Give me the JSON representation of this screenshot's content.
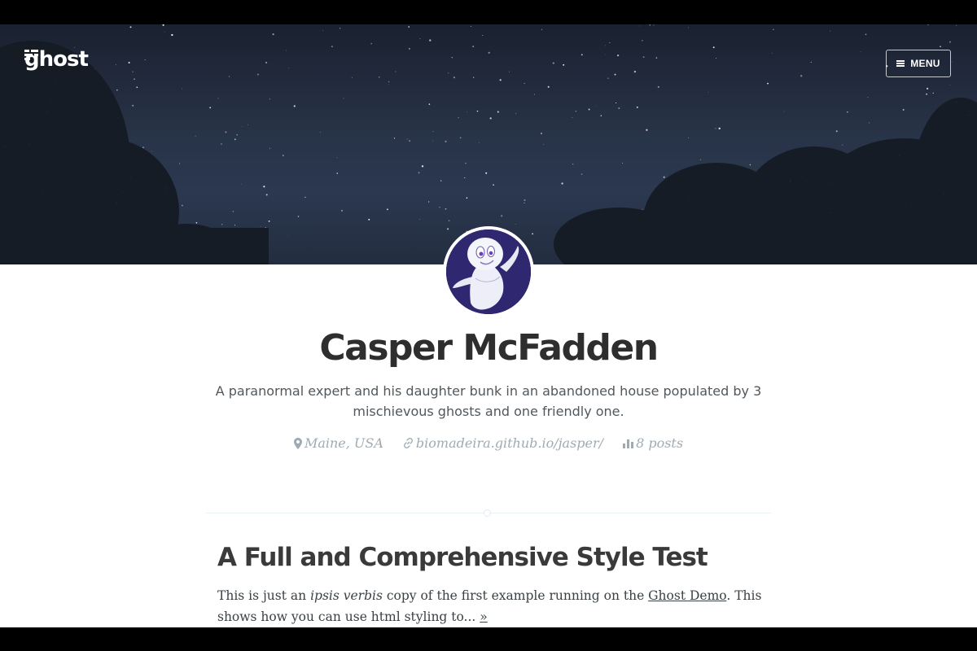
{
  "header": {
    "brand_icon": "ghost-logo-icon",
    "brand": "ghost",
    "menu_icon": "hamburger-icon",
    "menu_label": "MENU"
  },
  "author": {
    "avatar_icon": "casper-ghost-avatar",
    "name": "Casper McFadden",
    "bio": "A paranormal expert and his daughter bunk in an abandoned house populated by 3 mischievous ghosts and one friendly one.",
    "location_icon": "map-pin-icon",
    "location": "Maine, USA",
    "website_icon": "link-icon",
    "website": "biomadeira.github.io/jasper/",
    "posts_icon": "stats-icon",
    "posts": "8 posts"
  },
  "post": {
    "title": "A Full and Comprehensive Style Test",
    "excerpt_before": "This is just an ",
    "excerpt_em": "ipsis verbis",
    "excerpt_middle": " copy of the first example running on the ",
    "excerpt_link": "Ghost Demo",
    "excerpt_after": ". This shows how you can use html styling to... ",
    "read_more": "»"
  },
  "colors": {
    "sky": "#283347",
    "title": "#2e2e2e",
    "meta": "#9eabb3",
    "text": "#3a4145"
  }
}
